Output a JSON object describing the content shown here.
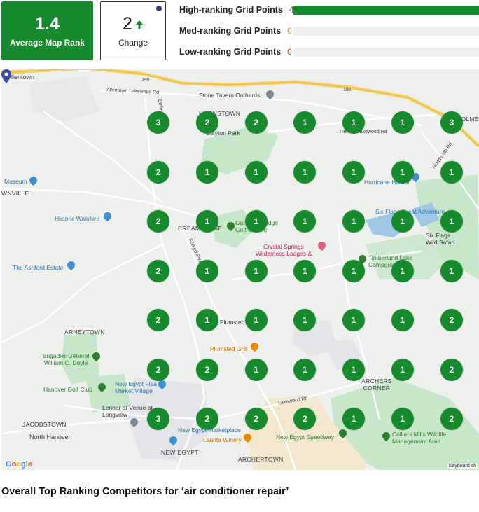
{
  "summary": {
    "average_rank": "1.4",
    "average_rank_label": "Average Map Rank",
    "change_value": "2",
    "change_label": "Change",
    "change_direction": "up",
    "accent_color": "#168a2c"
  },
  "ranking_breakdown": [
    {
      "label": "High-ranking Grid Points",
      "count": "49",
      "count_color": "#168a2c",
      "fill_fraction": 1.0
    },
    {
      "label": "Med-ranking Grid Points",
      "count": "0",
      "count_color": "#c9a227",
      "fill_fraction": 0.0
    },
    {
      "label": "Low-ranking Grid Points",
      "count": "0",
      "count_color": "#c0392b",
      "fill_fraction": 0.0
    }
  ],
  "map": {
    "labels": [
      {
        "text": "Allentown",
        "style": ""
      },
      {
        "text": "Stone Tavern Orchards",
        "style": ""
      },
      {
        "text": "Clayton Park",
        "style": ""
      },
      {
        "text": "HOLMES",
        "style": "caps"
      },
      {
        "text": "Museum",
        "style": "poi"
      },
      {
        "text": "Hurricane Harbor",
        "style": "poi"
      },
      {
        "text": "Historic Walnford",
        "style": "poi"
      },
      {
        "text": "Gambling Ridge Golf Course",
        "style": "poi-green"
      },
      {
        "text": "Six Flags Great Adventure",
        "style": "poi"
      },
      {
        "text": "Six Flags Wild Safari",
        "style": ""
      },
      {
        "text": "CREAM RIDGE",
        "style": "caps"
      },
      {
        "text": "Crystal Springs Wilderness Lodges &",
        "style": "poi-pink"
      },
      {
        "text": "Timberland Lake Campground",
        "style": "poi-green"
      },
      {
        "text": "The Ashford Estate",
        "style": "poi"
      },
      {
        "text": "ARNEYTOWN",
        "style": "caps"
      },
      {
        "text": "Plumsted Grill",
        "style": "poi-orange"
      },
      {
        "text": "Brigadier General William C. Doyle",
        "style": "poi-green"
      },
      {
        "text": "ARCHERS CORNER",
        "style": "caps"
      },
      {
        "text": "Hanover Golf Club",
        "style": "poi-green"
      },
      {
        "text": "New Egypt Flea Market Village",
        "style": "poi"
      },
      {
        "text": "Lennar at Venue at Longview",
        "style": ""
      },
      {
        "text": "JACOBSTOWN",
        "style": "caps"
      },
      {
        "text": "North Hanover",
        "style": ""
      },
      {
        "text": "New Egypt Marketplace",
        "style": "poi"
      },
      {
        "text": "Laurita Winery",
        "style": "poi-orange"
      },
      {
        "text": "New Egypt Speedway",
        "style": "poi-green"
      },
      {
        "text": "Colliers Mills Wildlife Management Area",
        "style": "poi-green"
      },
      {
        "text": "NEW EGYPT",
        "style": "caps"
      },
      {
        "text": "ARCHERTOWN",
        "style": "caps"
      },
      {
        "text": "WNVILLE",
        "style": "caps"
      },
      {
        "text": "HORNSTOWN",
        "style": "caps"
      },
      {
        "text": "Plumsted",
        "style": ""
      }
    ],
    "road_labels": [
      "195",
      "195",
      "Allentown Lakewood Rd",
      "Trenton Lakewood Rd",
      "Emley Hill Rd",
      "Monmouth Rd",
      "Lakewood Rd",
      "Forked River Rd"
    ],
    "grid_ranks": [
      [
        3,
        2,
        2,
        1,
        1,
        1,
        3
      ],
      [
        2,
        1,
        1,
        1,
        1,
        1,
        1
      ],
      [
        2,
        1,
        1,
        1,
        1,
        1,
        1
      ],
      [
        2,
        1,
        1,
        1,
        1,
        1,
        1
      ],
      [
        2,
        1,
        1,
        1,
        1,
        1,
        2
      ],
      [
        2,
        2,
        1,
        1,
        1,
        1,
        2
      ],
      [
        3,
        2,
        2,
        2,
        1,
        1,
        2
      ]
    ],
    "attribution": "Google",
    "keyboard_hint": "Keyboard sh"
  },
  "section_title": "Overall Top Ranking Competitors for ‘air conditioner repair’"
}
